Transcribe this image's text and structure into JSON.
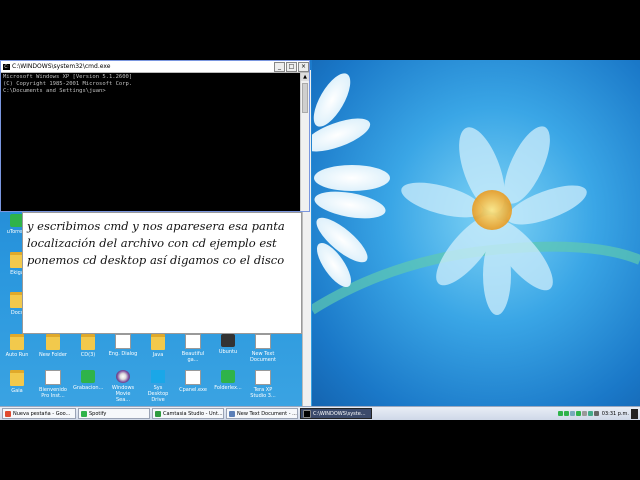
{
  "cmd": {
    "title": "C:\\WINDOWS\\system32\\cmd.exe",
    "lines": [
      "Microsoft Windows XP [Version 5.1.2600]",
      "(C) Copyright 1985-2001 Microsoft Corp.",
      "",
      "C:\\Documents and Settings\\juan>"
    ],
    "minimize": "_",
    "maximize": "□",
    "close": "×"
  },
  "text_window": {
    "lines": [
      "y escribimos cmd y nos aparesera esa panta",
      "localización del archivo con cd ejemplo est",
      "ponemos cd desktop así digamos co el disco"
    ]
  },
  "desktop_icons_row1": [
    "Auto Run",
    "New Folder",
    "CD(3)",
    "Eng. Dialog",
    "Java",
    "Beautiful ga...",
    "Ubuntu",
    "New Text Document"
  ],
  "desktop_icons_row2": [
    "Gaia",
    "Bienvenido Pro Inst...",
    "Grabacion...",
    "Windows Movie Sea...",
    "Sys Desktop Drive",
    "Cpanel.exe",
    "Folderlex...",
    "Tera XP Studio 3..."
  ],
  "desktop_icons_left": [
    "uTorrent",
    "Ekiga",
    "Docs"
  ],
  "taskbar": {
    "tasks": [
      {
        "label": "Nueva pestaña - Goo...",
        "color": "#e04a2f"
      },
      {
        "label": "Spotify",
        "color": "#2fb34a"
      },
      {
        "label": "Camtasia Studio - Unt...",
        "color": "#2e9b3e"
      },
      {
        "label": "New Text Document - ...",
        "color": "#5b7fb8"
      },
      {
        "label": "C:\\WINDOWS\\syste...",
        "color": "#000000"
      }
    ],
    "clock": "03:31 p.m."
  },
  "colors": {
    "wallpaper": "#3aa6e6",
    "cmd_text": "#c0c0c0"
  }
}
